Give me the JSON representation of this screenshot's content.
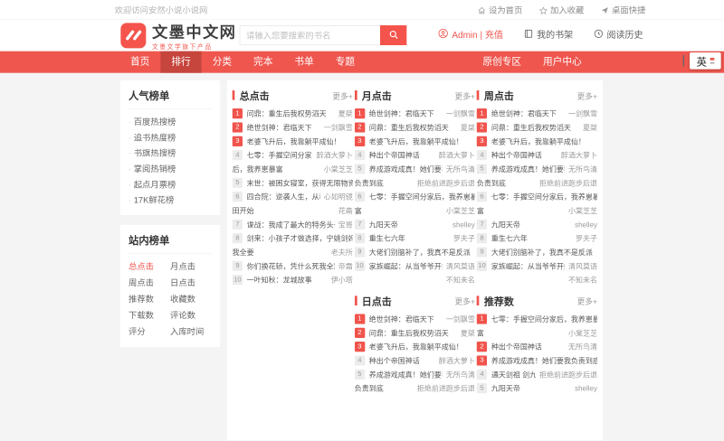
{
  "topbar": {
    "welcome": "欢迎访问安然小说小说网",
    "links": [
      {
        "icon": "home-icon",
        "label": "设为首页"
      },
      {
        "icon": "star-icon",
        "label": "加入收藏"
      },
      {
        "icon": "shortcut-icon",
        "label": "桌面快捷"
      }
    ]
  },
  "header": {
    "logo_title": "文墨中文网",
    "logo_subtitle": "文墨文学旗下产品",
    "search_placeholder": "请输入您要搜索的书名",
    "account": "Admin | 充值",
    "bookshelf": "我的书架",
    "history": "阅读历史"
  },
  "nav": {
    "items": [
      "首页",
      "排行",
      "分类",
      "完本",
      "书单",
      "专题"
    ],
    "active_index": 1,
    "right_items": [
      "原创专区",
      "用户中心"
    ]
  },
  "ime_badge": "英",
  "sidebar": {
    "hot_title": "人气榜单",
    "hot_items": [
      "百度热搜榜",
      "追书热度榜",
      "书旗热搜榜",
      "掌阅热销榜",
      "起点月票榜",
      "17K鲜花榜"
    ],
    "site_title": "站内榜单",
    "site_items": [
      {
        "label": "总点击",
        "active": true
      },
      {
        "label": "月点击",
        "active": false
      },
      {
        "label": "周点击",
        "active": false
      },
      {
        "label": "日点击",
        "active": false
      },
      {
        "label": "推荐数",
        "active": false
      },
      {
        "label": "收藏数",
        "active": false
      },
      {
        "label": "下载数",
        "active": false
      },
      {
        "label": "评论数",
        "active": false
      },
      {
        "label": "评分",
        "active": false
      },
      {
        "label": "入库时间",
        "active": false
      }
    ]
  },
  "more_label": "更多+",
  "colors": {
    "accent": "#f0544c",
    "nav_bg": "#ef564e",
    "nav_active": "#c6463e"
  },
  "columns": [
    [
      {
        "title": "总点击",
        "items": [
          {
            "rank": 1,
            "lines": [
              {
                "t": "问鼎：重生后我权势滔天",
                "a": "夏桀"
              }
            ]
          },
          {
            "rank": 2,
            "lines": [
              {
                "t": "绝世剑神：君临天下",
                "a": "一剑飘雪"
              }
            ]
          },
          {
            "rank": 3,
            "lines": [
              {
                "t": "老婆飞升后，我靠躺平成仙！",
                "a": ""
              }
            ]
          },
          {
            "rank": 4,
            "lines": [
              {
                "t": "七零：手握空间分家",
                "a": "醉酒大萝卜"
              },
              {
                "t": "后，我养崽暴富",
                "a": "小棠芝芝"
              }
            ]
          },
          {
            "rank": 5,
            "lines": [
              {
                "t": "末世：被困女寝室，获得无限物资",
                "a": ""
              }
            ]
          },
          {
            "rank": 6,
            "lines": [
              {
                "t": "四合院：逆袭人生，从种",
                "a": "心如明镜"
              },
              {
                "t": "田开始",
                "a": "花斋"
              }
            ]
          },
          {
            "rank": 7,
            "lines": [
              {
                "t": "谍战：我成了最大的特务头子",
                "a": "宝哥"
              }
            ]
          },
          {
            "rank": 8,
            "lines": [
              {
                "t": "剑来：小孩子才做选择，宁姚剑妈",
                "a": ""
              },
              {
                "t": "我全要",
                "a": "老夫所"
              }
            ]
          },
          {
            "rank": 9,
            "lines": [
              {
                "t": "你们换花轿，凭什么死我全家",
                "a": "帝霜"
              }
            ]
          },
          {
            "rank": 10,
            "lines": [
              {
                "t": "一叶知秋：龙城故事",
                "a": "伊小塔"
              }
            ]
          }
        ]
      }
    ],
    [
      {
        "title": "月点击",
        "items": [
          {
            "rank": 1,
            "lines": [
              {
                "t": "绝世剑神：君临天下",
                "a": "一剑飘雪"
              }
            ]
          },
          {
            "rank": 2,
            "lines": [
              {
                "t": "问鼎：重生后我权势滔天",
                "a": "夏桀"
              }
            ]
          },
          {
            "rank": 3,
            "lines": [
              {
                "t": "老婆飞升后，我靠躺平成仙！",
                "a": ""
              }
            ]
          },
          {
            "rank": 4,
            "lines": [
              {
                "t": "种出个帝国神话",
                "a": "醉酒大萝卜"
              }
            ]
          },
          {
            "rank": 5,
            "lines": [
              {
                "t": "养成游戏成真！她们要我",
                "a": "无所鸟清"
              },
              {
                "t": "负责到底",
                "a": "拒绝前进跑步后退"
              }
            ]
          },
          {
            "rank": 6,
            "lines": [
              {
                "t": "七零：手握空间分家后，我养崽暴",
                "a": ""
              },
              {
                "t": "富",
                "a": "小棠芝芝"
              }
            ]
          },
          {
            "rank": 7,
            "lines": [
              {
                "t": "九阳天帝",
                "a": "shelley"
              }
            ]
          },
          {
            "rank": 8,
            "lines": [
              {
                "t": "重生七六年",
                "a": "罗夫子"
              }
            ]
          },
          {
            "rank": 9,
            "lines": [
              {
                "t": "大佬们别脑补了，我真不是反派",
                "a": ""
              }
            ]
          },
          {
            "rank": 10,
            "lines": [
              {
                "t": "家族崛起：从当爷爷开始",
                "a": "清风莫语"
              },
              {
                "t": "",
                "a": "不知未名"
              }
            ]
          }
        ]
      },
      {
        "title": "日点击",
        "items": [
          {
            "rank": 1,
            "lines": [
              {
                "t": "绝世剑神：君临天下",
                "a": "一剑飘雪"
              }
            ]
          },
          {
            "rank": 2,
            "lines": [
              {
                "t": "问鼎：重生后我权势滔天",
                "a": "夏桀"
              }
            ]
          },
          {
            "rank": 3,
            "lines": [
              {
                "t": "老婆飞升后，我靠躺平成仙！",
                "a": ""
              }
            ]
          },
          {
            "rank": 4,
            "lines": [
              {
                "t": "种出个帝国神话",
                "a": "醉酒大萝卜"
              }
            ]
          },
          {
            "rank": 5,
            "lines": [
              {
                "t": "养成游戏成真！她们要我",
                "a": "无所鸟清"
              },
              {
                "t": "负责到底",
                "a": "拒绝前进跑步后退"
              }
            ]
          }
        ]
      }
    ],
    [
      {
        "title": "周点击",
        "items": [
          {
            "rank": 1,
            "lines": [
              {
                "t": "绝世剑神：君临天下",
                "a": "一剑飘雪"
              }
            ]
          },
          {
            "rank": 2,
            "lines": [
              {
                "t": "问鼎：重生后我权势滔天",
                "a": "夏桀"
              }
            ]
          },
          {
            "rank": 3,
            "lines": [
              {
                "t": "老婆飞升后，我靠躺平成仙！",
                "a": ""
              }
            ]
          },
          {
            "rank": 4,
            "lines": [
              {
                "t": "种出个帝国神话",
                "a": "醉酒大萝卜"
              }
            ]
          },
          {
            "rank": 5,
            "lines": [
              {
                "t": "养成游戏成真！她们要我",
                "a": "无所鸟清"
              },
              {
                "t": "负责到底",
                "a": "拒绝前进跑步后退"
              }
            ]
          },
          {
            "rank": 6,
            "lines": [
              {
                "t": "七零：手握空间分家后，我养崽暴",
                "a": ""
              },
              {
                "t": "富",
                "a": "小棠芝芝"
              }
            ]
          },
          {
            "rank": 7,
            "lines": [
              {
                "t": "九阳天帝",
                "a": "shelley"
              }
            ]
          },
          {
            "rank": 8,
            "lines": [
              {
                "t": "重生七六年",
                "a": "罗夫子"
              }
            ]
          },
          {
            "rank": 9,
            "lines": [
              {
                "t": "大佬们别脑补了，我真不是反派",
                "a": ""
              }
            ]
          },
          {
            "rank": 10,
            "lines": [
              {
                "t": "家族崛起：从当爷爷开始",
                "a": "清风莫语"
              },
              {
                "t": "",
                "a": "不知未名"
              }
            ]
          }
        ]
      },
      {
        "title": "推荐数",
        "items": [
          {
            "rank": 1,
            "lines": [
              {
                "t": "七零：手握空间分家后，我养崽暴",
                "a": ""
              },
              {
                "t": "富",
                "a": "小棠芝芝"
              }
            ]
          },
          {
            "rank": 2,
            "lines": [
              {
                "t": "种出个帝国神话",
                "a": "无所鸟清"
              }
            ]
          },
          {
            "rank": 3,
            "lines": [
              {
                "t": "养成游戏成真！她们要我负责到底",
                "a": ""
              }
            ]
          },
          {
            "rank": 4,
            "lines": [
              {
                "t": "通天剑祖 剑九歌",
                "a": "拒绝前进跑步后退"
              }
            ]
          },
          {
            "rank": 5,
            "lines": [
              {
                "t": "九阳天帝",
                "a": "shelley"
              }
            ]
          }
        ]
      }
    ]
  ]
}
